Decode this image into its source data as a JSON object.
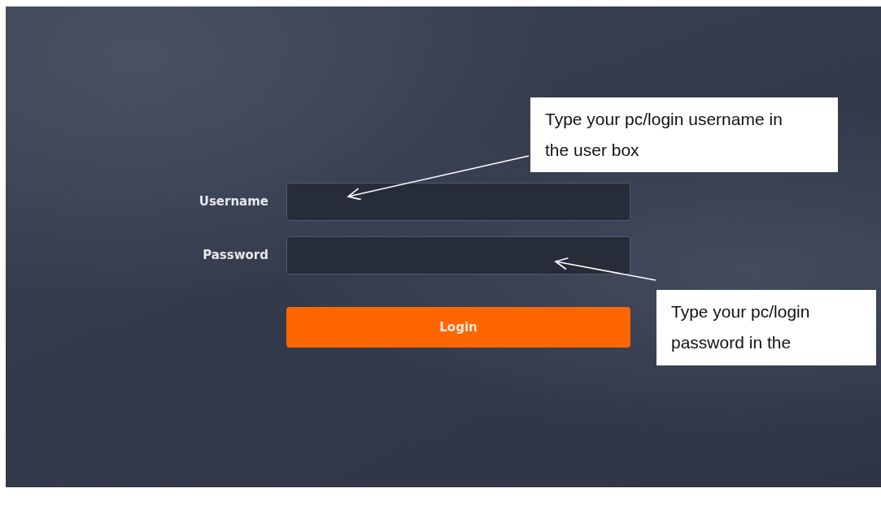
{
  "login_form": {
    "fields": [
      {
        "label": "Username"
      },
      {
        "label": "Password"
      }
    ],
    "button": "Login"
  },
  "annotations": [
    {
      "text": "Type your pc/login username in the user box"
    },
    {
      "text": "Type your pc/login password in the"
    }
  ]
}
